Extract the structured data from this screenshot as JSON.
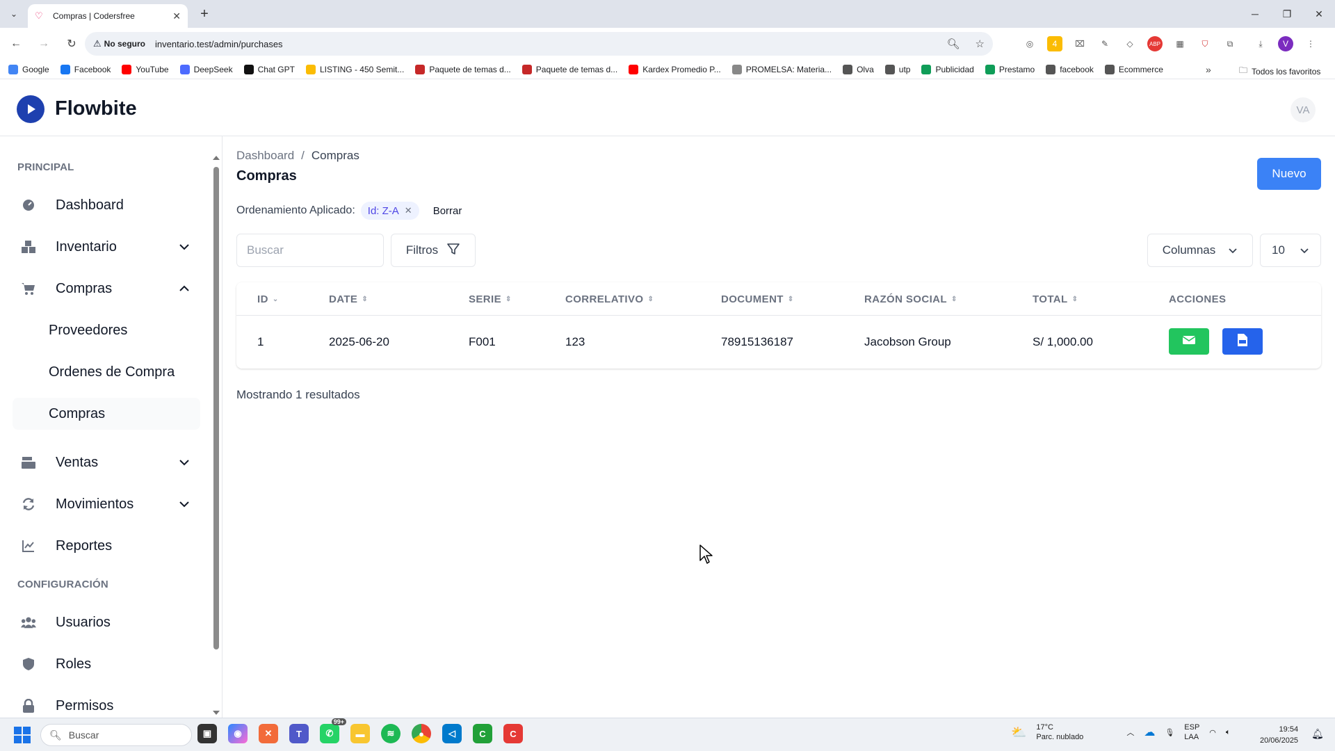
{
  "browser": {
    "tab_title": "Compras | Codersfree",
    "security_label": "No seguro",
    "url": "inventario.test/admin/purchases",
    "bookmarks": [
      {
        "label": "Google",
        "color": "#4285f4"
      },
      {
        "label": "Facebook",
        "color": "#1877f2"
      },
      {
        "label": "YouTube",
        "color": "#ff0000"
      },
      {
        "label": "DeepSeek",
        "color": "#4d6bfe"
      },
      {
        "label": "Chat GPT",
        "color": "#111111"
      },
      {
        "label": "LISTING - 450 Semit...",
        "color": "#fbbc04"
      },
      {
        "label": "Paquete de temas d...",
        "color": "#c62828"
      },
      {
        "label": "Paquete de temas d...",
        "color": "#c62828"
      },
      {
        "label": "Kardex Promedio P...",
        "color": "#ff0000"
      },
      {
        "label": "PROMELSA: Materia...",
        "color": "#888888"
      },
      {
        "label": "Olva",
        "color": "#555555"
      },
      {
        "label": "utp",
        "color": "#555555"
      },
      {
        "label": "Publicidad",
        "color": "#0f9d58"
      },
      {
        "label": "Prestamo",
        "color": "#0f9d58"
      },
      {
        "label": "facebook",
        "color": "#555555"
      },
      {
        "label": "Ecommerce",
        "color": "#555555"
      }
    ],
    "all_bookmarks": "Todos los favoritos",
    "profile_initial": "V"
  },
  "app": {
    "brand": "Flowbite",
    "avatar_initials": "VA",
    "accent_color": "#3b82f6"
  },
  "sidebar": {
    "section_main": "PRINCIPAL",
    "section_config": "CONFIGURACIÓN",
    "items": {
      "dashboard": "Dashboard",
      "inventario": "Inventario",
      "compras": "Compras",
      "ventas": "Ventas",
      "movimientos": "Movimientos",
      "reportes": "Reportes",
      "usuarios": "Usuarios",
      "roles": "Roles",
      "permisos": "Permisos"
    },
    "compras_sub": {
      "proveedores": "Proveedores",
      "ordenes": "Ordenes de Compra",
      "compras": "Compras"
    }
  },
  "page": {
    "breadcrumb_root": "Dashboard",
    "breadcrumb_sep": "/",
    "breadcrumb_current": "Compras",
    "title": "Compras",
    "new_button": "Nuevo",
    "sort_label": "Ordenamiento Aplicado:",
    "sort_chip": "Id: Z-A",
    "clear_label": "Borrar",
    "search_placeholder": "Buscar",
    "filters_label": "Filtros",
    "columns_label": "Columnas",
    "per_page": "10",
    "results_text": "Mostrando 1 resultados"
  },
  "table": {
    "headers": {
      "id": "ID",
      "date": "DATE",
      "serie": "SERIE",
      "correlativo": "CORRELATIVO",
      "document": "DOCUMENT",
      "razon": "RAZÓN SOCIAL",
      "total": "TOTAL",
      "acciones": "ACCIONES"
    },
    "rows": [
      {
        "id": "1",
        "date": "2025-06-20",
        "serie": "F001",
        "correlativo": "123",
        "document": "78915136187",
        "razon": "Jacobson Group",
        "total": "S/ 1,000.00"
      }
    ]
  },
  "taskbar": {
    "search_label": "Buscar",
    "whatsapp_badge": "99+",
    "weather_temp": "17°C",
    "weather_desc": "Parc. nublado",
    "lang_top": "ESP",
    "lang_bottom": "LAA",
    "time": "19:54",
    "date": "20/06/2025"
  }
}
